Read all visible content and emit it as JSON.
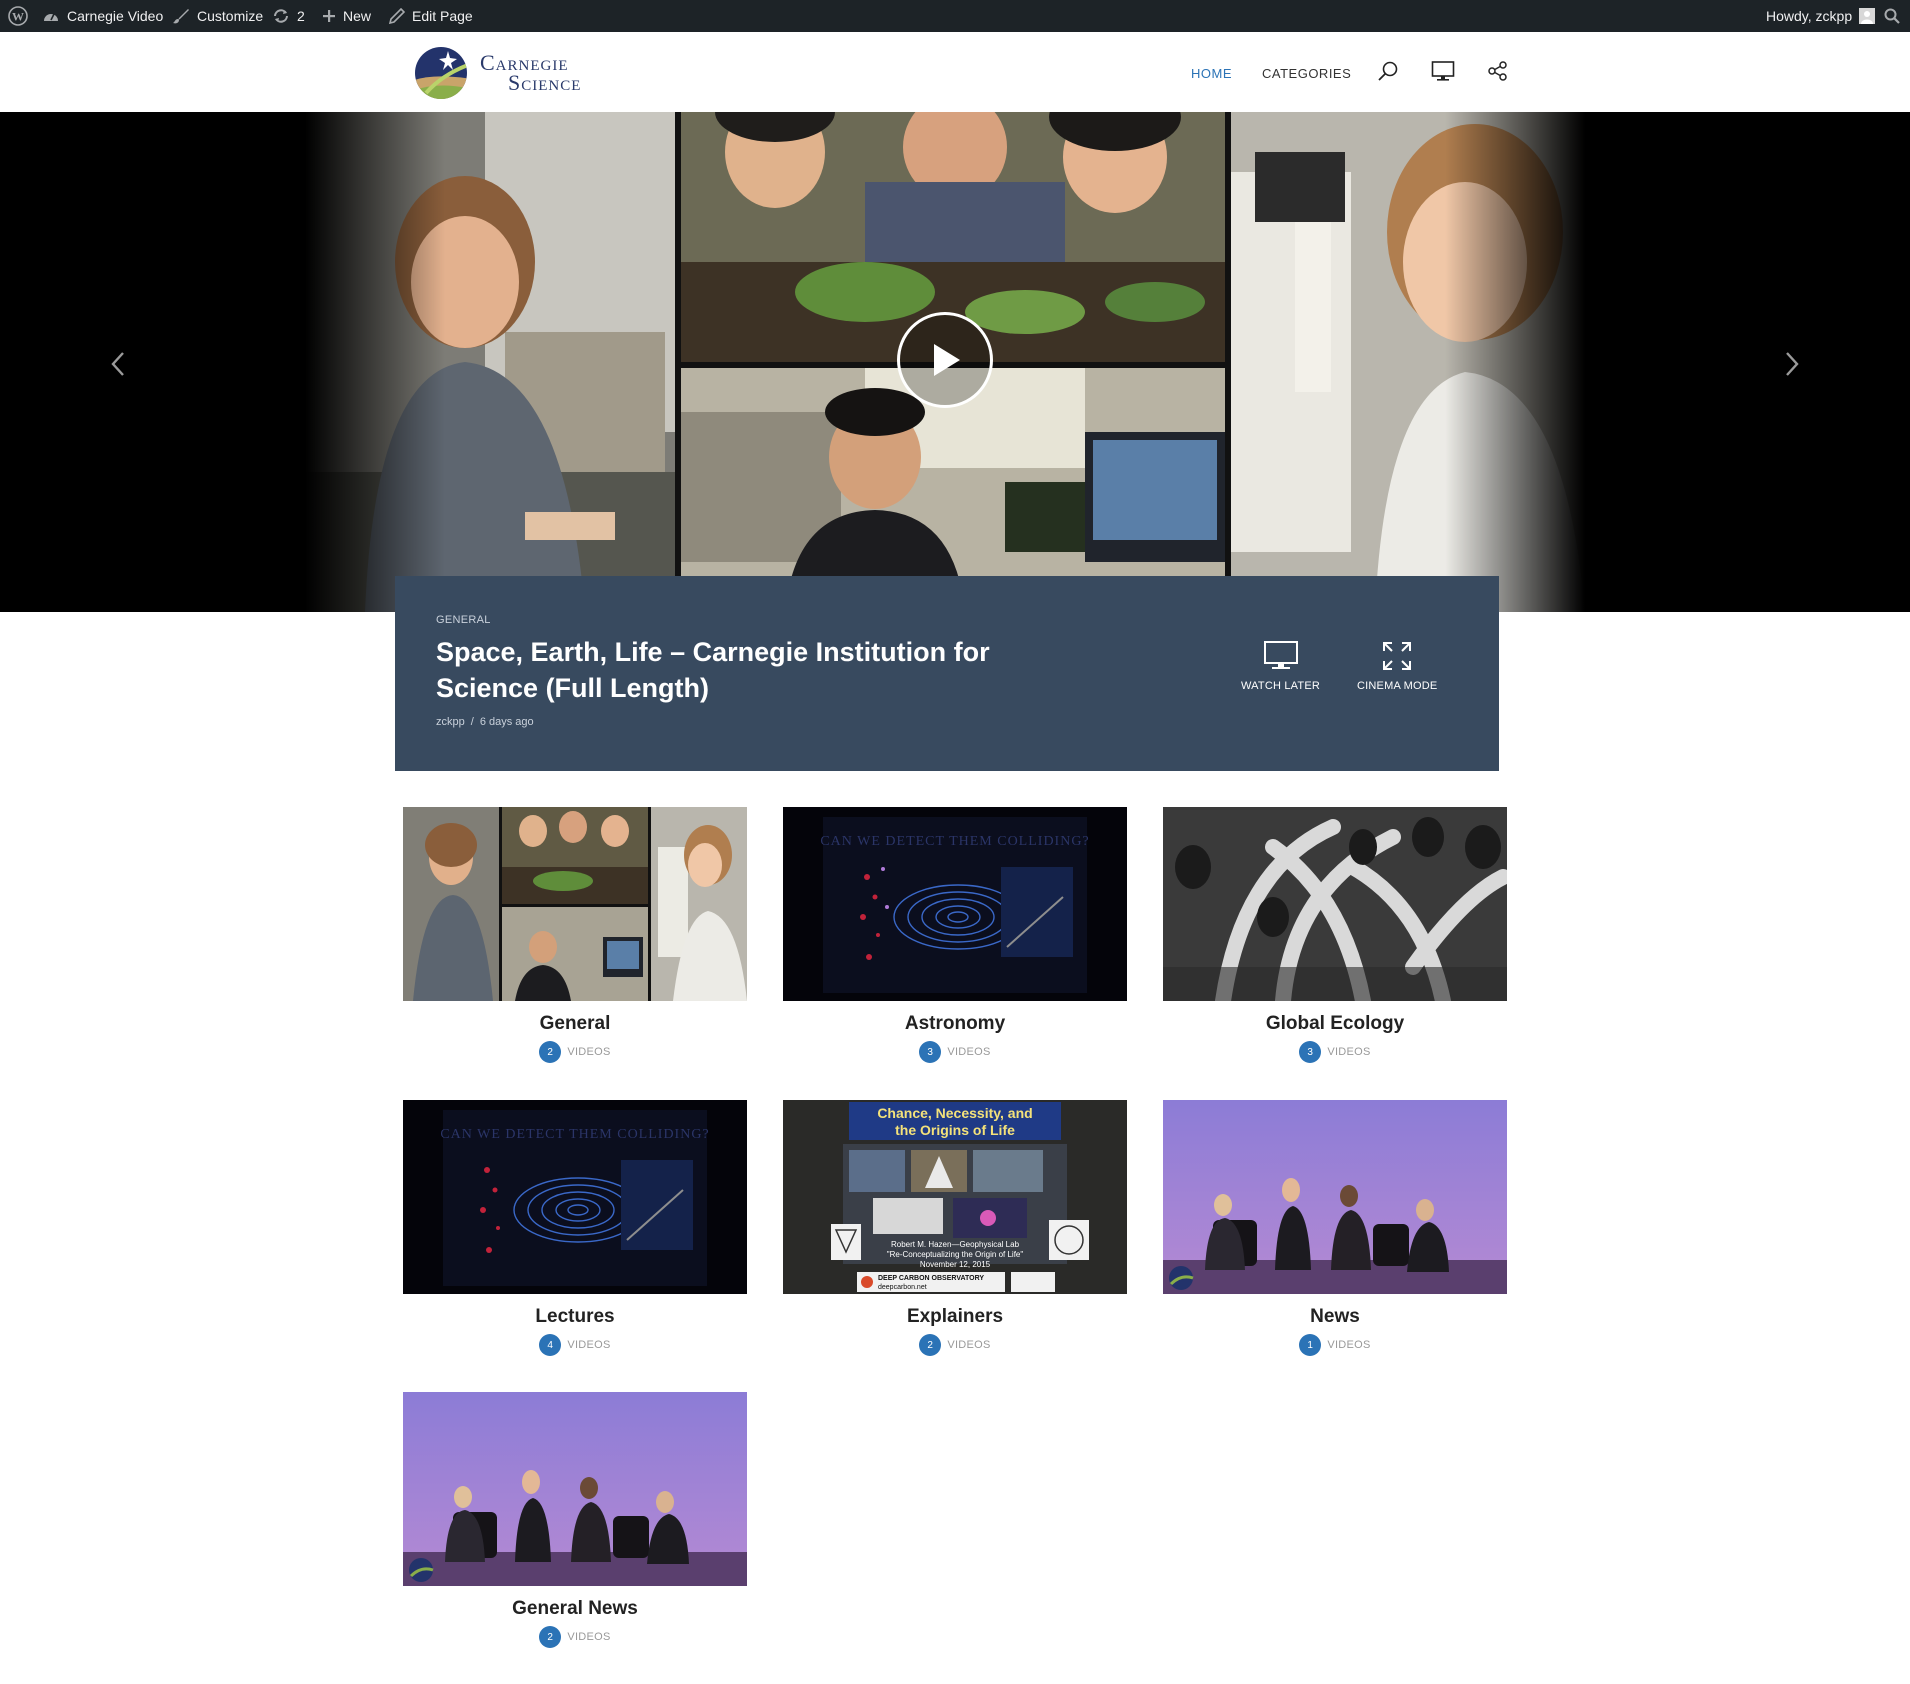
{
  "adminbar": {
    "site_name": "Carnegie Video",
    "customize": "Customize",
    "updates_count": "2",
    "new_label": "New",
    "edit_page": "Edit Page",
    "howdy": "Howdy, zckpp"
  },
  "header": {
    "logo_line1": "Carnegie",
    "logo_line2": "Science",
    "nav": {
      "home": "HOME",
      "categories": "CATEGORIES"
    }
  },
  "hero": {
    "category": "GENERAL",
    "title": "Space, Earth, Life – Carnegie Institution for Science (Full Length)",
    "author": "zckpp",
    "separator": "/",
    "date": "6 days ago",
    "watch_later": "WATCH LATER",
    "cinema_mode": "CINEMA MODE"
  },
  "categories": [
    {
      "title": "General",
      "count": "2",
      "unit": "VIDEOS"
    },
    {
      "title": "Astronomy",
      "count": "3",
      "unit": "VIDEOS"
    },
    {
      "title": "Global Ecology",
      "count": "3",
      "unit": "VIDEOS"
    },
    {
      "title": "Lectures",
      "count": "4",
      "unit": "VIDEOS"
    },
    {
      "title": "Explainers",
      "count": "2",
      "unit": "VIDEOS"
    },
    {
      "title": "News",
      "count": "1",
      "unit": "VIDEOS"
    },
    {
      "title": "General News",
      "count": "2",
      "unit": "VIDEOS"
    }
  ],
  "thumb_text": {
    "astronomy": "CAN WE DETECT THEM COLLIDING?",
    "explainers_title1": "Chance, Necessity, and",
    "explainers_title2": "the Origins of Life",
    "explainers_caption1": "Robert M. Hazen—Geophysical Lab",
    "explainers_caption2": "\"Re-Conceptualizing the Origin of Life\"",
    "explainers_caption3": "November 12, 2015",
    "explainers_logo1": "DEEP CARBON OBSERVATORY",
    "explainers_logo2": "deepcarbon.net"
  },
  "colors": {
    "adminbar": "#1d2327",
    "accent": "#2b73b6",
    "infobox": "#384a5f"
  }
}
